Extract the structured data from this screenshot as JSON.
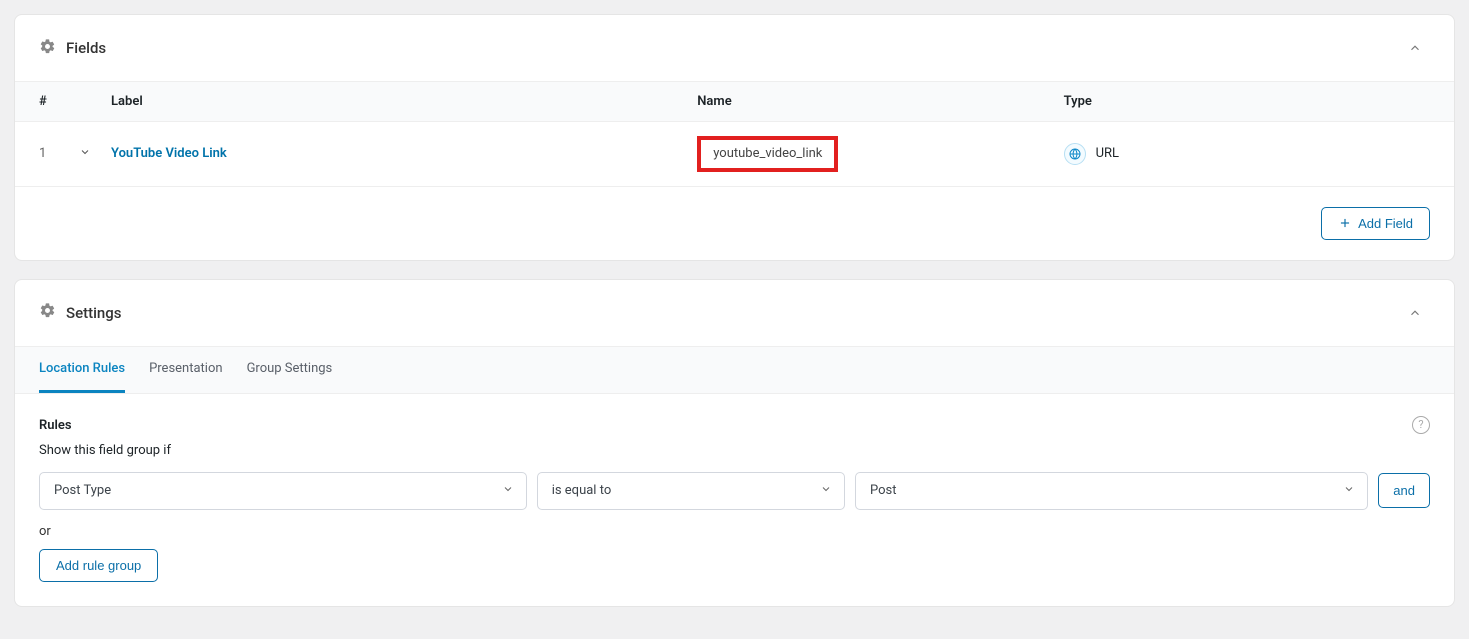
{
  "fields_panel": {
    "title": "Fields",
    "columns": {
      "num": "#",
      "label": "Label",
      "name": "Name",
      "type": "Type"
    },
    "rows": [
      {
        "num": "1",
        "label": "YouTube Video Link",
        "name": "youtube_video_link",
        "type": "URL"
      }
    ],
    "add_field_label": "Add Field"
  },
  "settings_panel": {
    "title": "Settings",
    "tabs": {
      "location_rules": "Location Rules",
      "presentation": "Presentation",
      "group_settings": "Group Settings"
    },
    "rules": {
      "heading": "Rules",
      "show_if": "Show this field group if",
      "select_param": "Post Type",
      "select_operator": "is equal to",
      "select_value": "Post",
      "and_label": "and",
      "or_label": "or",
      "add_rule_group": "Add rule group"
    }
  }
}
